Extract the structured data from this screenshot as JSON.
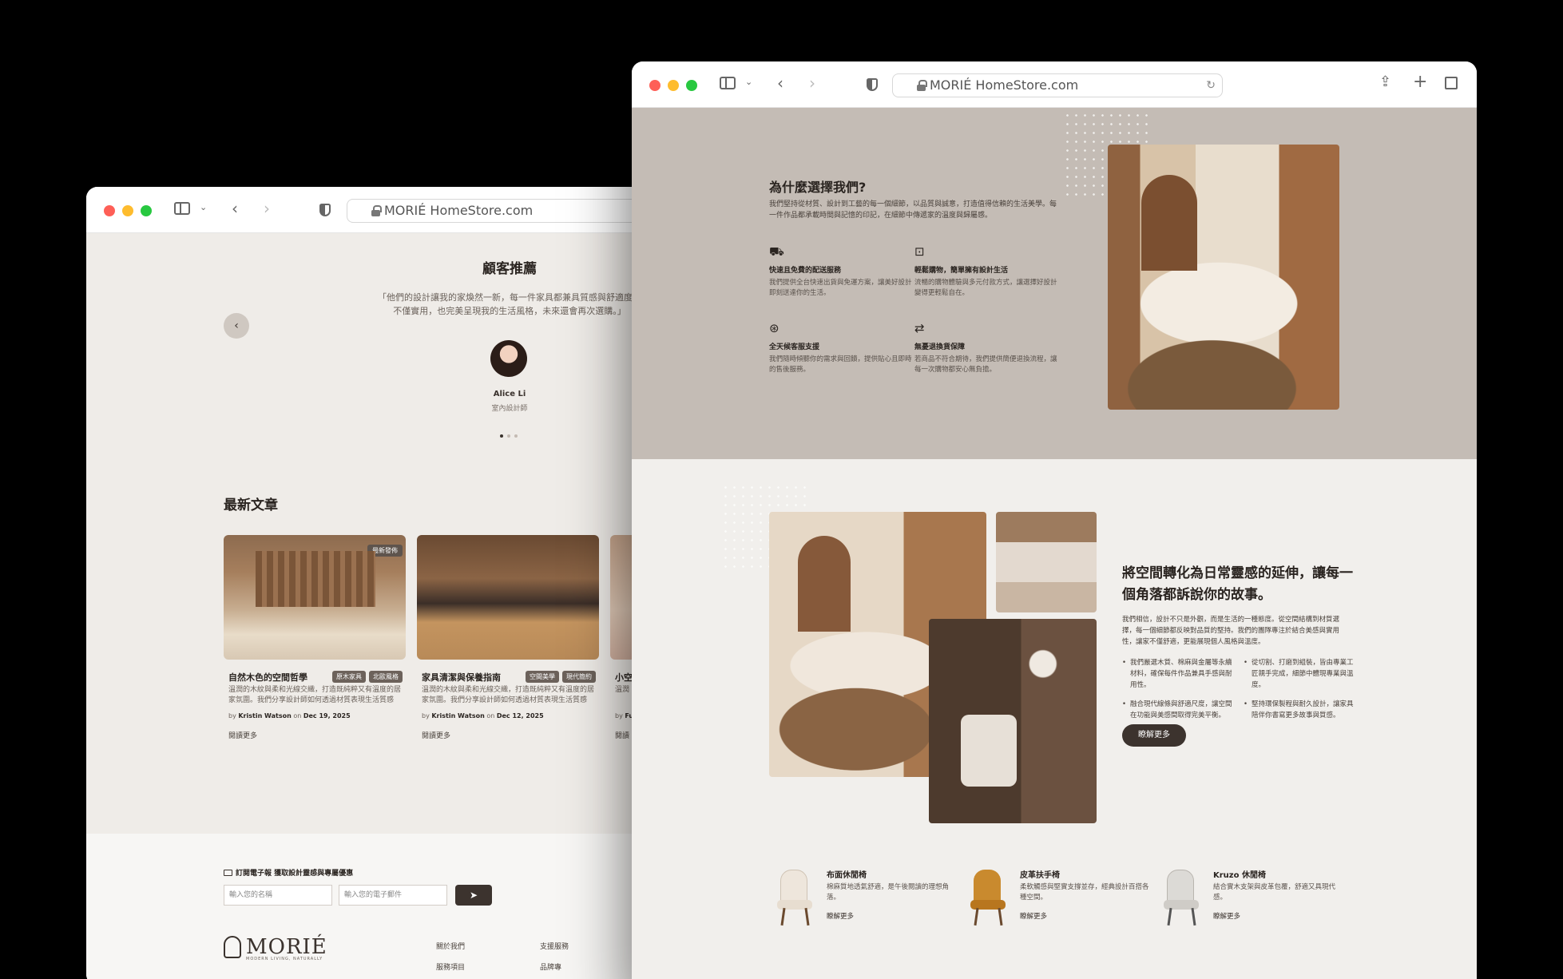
{
  "browser": {
    "address": "MORIÉ HomeStore.com",
    "icons": {
      "sidebar": "sidebar-icon",
      "back": "chevron-left-icon",
      "forward": "chevron-right-icon",
      "privacy": "shield-icon",
      "reload": "reload-icon",
      "share": "share-icon",
      "new_tab": "plus-icon",
      "tabs": "grid-icon"
    }
  },
  "left": {
    "testimonial": {
      "title": "顧客推薦",
      "quote": "「他們的設計讓我的家煥然一新，每一件家具都兼具質感與舒適度，不僅實用，也完美呈現我的生活風格，未來還會再次選購。」",
      "name": "Alice Li",
      "role": "室內設計師"
    },
    "articles": {
      "title": "最新文章",
      "items": [
        {
          "badge": "最新發佈",
          "title": "自然木色的空間哲學",
          "tags": [
            "原木家具",
            "北歐風格"
          ],
          "desc": "溫潤的木紋與柔和光線交織，打造既純粹又有溫度的居家氛圍。我們分享設計師如何透過材質表現生活質感",
          "by": "by",
          "author": "Kristin Watson",
          "on": "on",
          "date": "Dec 19, 2025",
          "more": "閱讀更多"
        },
        {
          "title": "家具清潔與保養指南",
          "tags": [
            "空間美學",
            "現代簡約"
          ],
          "desc": "溫潤的木紋與柔和光線交織，打造既純粹又有溫度的居家氛圍。我們分享設計師如何透過材質表現生活質感",
          "by": "by",
          "author": "Kristin Watson",
          "on": "on",
          "date": "Dec 12, 2025",
          "more": "閱讀更多"
        },
        {
          "title": "小空",
          "desc": "溫潤",
          "by": "by",
          "author": "Fu",
          "more": "閱讀"
        }
      ]
    },
    "newsletter": {
      "label": "訂閱電子報 獲取設計靈感與專屬優惠",
      "name_placeholder": "輸入您的名稱",
      "email_placeholder": "輸入您的電子郵件",
      "send_icon": "send-icon"
    },
    "footer": {
      "logo": "MORIÉ",
      "logo_sub": "MODERN LIVING, NATURALLY",
      "links": [
        "關於我們",
        "支援服務",
        "服務項目",
        "品牌專"
      ]
    }
  },
  "right": {
    "why": {
      "title": "為什麼選擇我們?",
      "desc": "我們堅持從材質、設計到工藝的每一個細節，以品質與誠意，打造值得信賴的生活美學。每一件作品都承載時間與記憶的印記，在細節中傳遞家的溫度與歸屬感。",
      "features": [
        {
          "icon": "truck-icon",
          "title": "快速且免費的配送服務",
          "desc": "我們提供全台快速出貨與免運方案，讓美好設計即刻送達你的生活。"
        },
        {
          "icon": "shopping-bag-icon",
          "title": "輕鬆購物，簡單擁有設計生活",
          "desc": "流暢的購物體驗與多元付款方式，讓選擇好設計變得更輕鬆自在。"
        },
        {
          "icon": "lifebuoy-icon",
          "title": "全天候客服支援",
          "desc": "我們隨時傾聽你的需求與回饋，提供貼心且即時的售後服務。"
        },
        {
          "icon": "exchange-icon",
          "title": "無憂退換貨保障",
          "desc": "若商品不符合期待，我們提供簡便退換流程，讓每一次購物都安心無負擔。"
        }
      ]
    },
    "story": {
      "title": "將空間轉化為日常靈感的延伸，讓每一個角落都訴說你的故事。",
      "desc": "我們相信，設計不只是外觀，而是生活的一種態度。從空間結構到材質選擇，每一個細節都反映對品質的堅持。我們的團隊專注於結合美感與實用性，讓家不僅舒適，更能展現個人風格與溫度。",
      "bullets": [
        "我們嚴選木質、棉麻與金屬等永續材料，確保每件作品兼具手感與耐用性。",
        "從切割、打磨到組裝，皆由專業工匠親手完成，細節中體現專業與溫度。",
        "融合現代線條與舒適尺度，讓空間在功能與美感間取得完美平衡。",
        "堅持環保製程與耐久設計，讓家具陪伴你書寫更多故事與質感。"
      ],
      "button": "瞭解更多"
    },
    "products": [
      {
        "title": "布面休閒椅",
        "desc": "棉麻質地透氣舒適，是午後閱讀的理想角落。",
        "more": "瞭解更多"
      },
      {
        "title": "皮革扶手椅",
        "desc": "柔軟觸感與堅實支撐並存，經典設計百搭各種空間。",
        "more": "瞭解更多"
      },
      {
        "title": "Kruzo 休閒椅",
        "desc": "結合實木支架與皮革包覆，舒適又具現代感。",
        "more": "瞭解更多"
      }
    ]
  }
}
